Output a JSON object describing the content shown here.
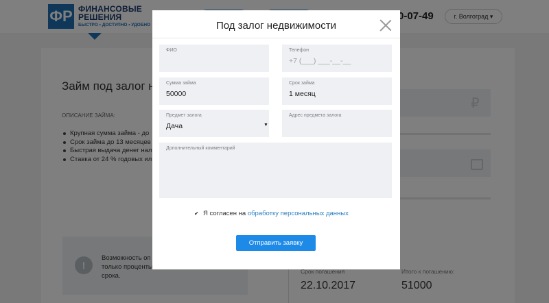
{
  "header": {
    "logo_mark": "ФР",
    "logo_title_line1": "ФИНАНСОВЫЕ",
    "logo_title_line2": "РЕШЕНИЯ",
    "logo_tagline": "БЫСТРО • ДОСТУПНО • УДОБНО",
    "phone": "0-07-49",
    "city": "г. Волгоград ▾"
  },
  "page": {
    "title": "Займ под залог не",
    "section_label": "ОПИСАНИЕ ЗАЙМА:",
    "bullets": [
      "Крупная сумма займа - до",
      "Срок займа до 13 месяцев",
      "Быстрая выдача денег нал",
      "Ставка от 24 % годовых ил"
    ],
    "info_icon": "!",
    "info_text": "Возможность оп только процентьы срока.",
    "ruble_icon": "₽",
    "due_label": "Срок погашения",
    "due_date": "22.10.2017",
    "total_label": "Итого к погашению:",
    "total_value": "51000"
  },
  "modal": {
    "title": "Под залог недвижимости",
    "fields": {
      "fio": {
        "label": "ФИО",
        "value": ""
      },
      "phone": {
        "label": "Телефон",
        "placeholder": "+7 (___) ___-__-__"
      },
      "sum": {
        "label": "Сумма займа",
        "value": "50000"
      },
      "term": {
        "label": "Срок займа",
        "value": "1 месяц"
      },
      "pledge": {
        "label": "Предмет залога",
        "value": "Дача",
        "caret": "▼"
      },
      "address": {
        "label": "Адрес предмета залога",
        "value": ""
      },
      "comment": {
        "label": "Дополнительный комментарий",
        "value": ""
      }
    },
    "agree_checkbox": "✔",
    "agree_text": "Я согласен на",
    "agree_link": "обработку персональных данных",
    "submit_label": "Отправить заявку"
  },
  "colors": {
    "accent": "#1e8ae8",
    "brand": "#1d6fb3",
    "link": "#2a7fc4"
  }
}
